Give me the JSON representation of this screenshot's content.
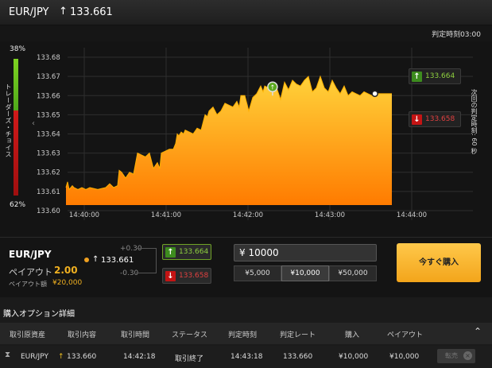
{
  "header": {
    "pair": "EUR/JPY",
    "arrow": "↑",
    "price": "133.661"
  },
  "subbar": {
    "judge_time": "判定時刻03:00"
  },
  "trader_choice": {
    "top_percent": "38%",
    "bottom_percent": "62%",
    "label": "トレーダーズ・チョイス",
    "call_share": 0.38
  },
  "chart_data": {
    "type": "area",
    "title": "",
    "xlabel": "",
    "ylabel": "",
    "x_ticks": [
      "14:40:00",
      "14:41:00",
      "14:42:00",
      "14:43:00",
      "14:44:00"
    ],
    "y_ticks": [
      "133.68",
      "133.67",
      "133.66",
      "133.65",
      "133.64",
      "133.63",
      "133.62",
      "133.61",
      "133.60"
    ],
    "ylim": [
      133.595,
      133.685
    ],
    "grid": true,
    "entry_marker": {
      "time": "14:42:18",
      "value": 133.66
    },
    "current_marker": {
      "time": "14:43:33",
      "value": 133.661
    },
    "series": [
      {
        "x": [
          0,
          2,
          4,
          8,
          10,
          15,
          20,
          25,
          30,
          40,
          50,
          55,
          60,
          65,
          67,
          70,
          75,
          80,
          85,
          90,
          100,
          105,
          110,
          115,
          118,
          120,
          125,
          130,
          135,
          138,
          140,
          142,
          145,
          148,
          150,
          155,
          160,
          165,
          170,
          175,
          178,
          180,
          185,
          190,
          195,
          200,
          205,
          210,
          215,
          218,
          220,
          225,
          230,
          235,
          240,
          245,
          248,
          250,
          255,
          260,
          265,
          270,
          275,
          280,
          285,
          290,
          295,
          300,
          305,
          310,
          315,
          320,
          325,
          330,
          335,
          340,
          345,
          350,
          355,
          360,
          365,
          370,
          375,
          380,
          385,
          390,
          395,
          400,
          405,
          410
        ],
        "values": [
          133.612,
          133.615,
          133.611,
          133.613,
          133.612,
          133.611,
          133.612,
          133.611,
          133.612,
          133.611,
          133.612,
          133.614,
          133.612,
          133.613,
          133.621,
          133.62,
          133.617,
          133.62,
          133.619,
          133.63,
          133.628,
          133.63,
          133.622,
          133.625,
          133.622,
          133.63,
          133.631,
          133.632,
          133.632,
          133.635,
          133.64,
          133.639,
          133.641,
          133.64,
          133.642,
          133.641,
          133.64,
          133.643,
          133.642,
          133.65,
          133.649,
          133.652,
          133.654,
          133.65,
          133.652,
          133.656,
          133.655,
          133.654,
          133.657,
          133.654,
          133.66,
          133.66,
          133.652,
          133.659,
          133.661,
          133.665,
          133.662,
          133.665,
          133.664,
          133.666,
          133.664,
          133.658,
          133.667,
          133.663,
          133.668,
          133.666,
          133.665,
          133.668,
          133.67,
          133.662,
          133.664,
          133.67,
          133.664,
          133.662,
          133.668,
          133.664,
          133.661,
          133.665,
          133.66,
          133.662,
          133.661,
          133.66,
          133.662,
          133.661,
          133.66,
          133.661,
          133.661,
          133.661,
          133.661,
          133.661
        ]
      }
    ]
  },
  "side_buttons": {
    "call_value": "133.664",
    "put_value": "133.658"
  },
  "next_judge_label": "次回の判定時刻: 60 秒",
  "panel": {
    "pair": "EUR/JPY",
    "payout_label": "ペイアウト",
    "payout_value": "2.00",
    "payout_amount_label": "ペイアウト額",
    "payout_amount": "¥20,000",
    "price_arrow": "↑",
    "price": "133.661",
    "plus": "+0.30",
    "minus": "-0.30",
    "call_value": "133.664",
    "put_value": "133.658",
    "amount_value": "¥ 10000",
    "amount_options": [
      "¥5,000",
      "¥10,000",
      "¥50,000"
    ],
    "buy_now": "今すぐ購入"
  },
  "details": {
    "title": "購入オプション詳細",
    "columns": [
      "取引原資産",
      "取引内容",
      "取引時間",
      "ステータス",
      "判定時刻",
      "判定レート",
      "購入",
      "ペイアウト"
    ],
    "rows": [
      {
        "asset": "EUR/JPY",
        "direction_arrow": "↑",
        "content": "133.660",
        "time": "14:42:18",
        "status": "取引終了",
        "judge_time": "14:43:18",
        "judge_rate": "133.660",
        "purchase": "¥10,000",
        "payout": "¥10,000",
        "sell_label": "転売"
      }
    ]
  },
  "colors": {
    "call": "#8fd13f",
    "put": "#e04040",
    "accent": "#f3a51b",
    "area_top": "#ffd23a",
    "area_bottom": "#ff7b00"
  }
}
